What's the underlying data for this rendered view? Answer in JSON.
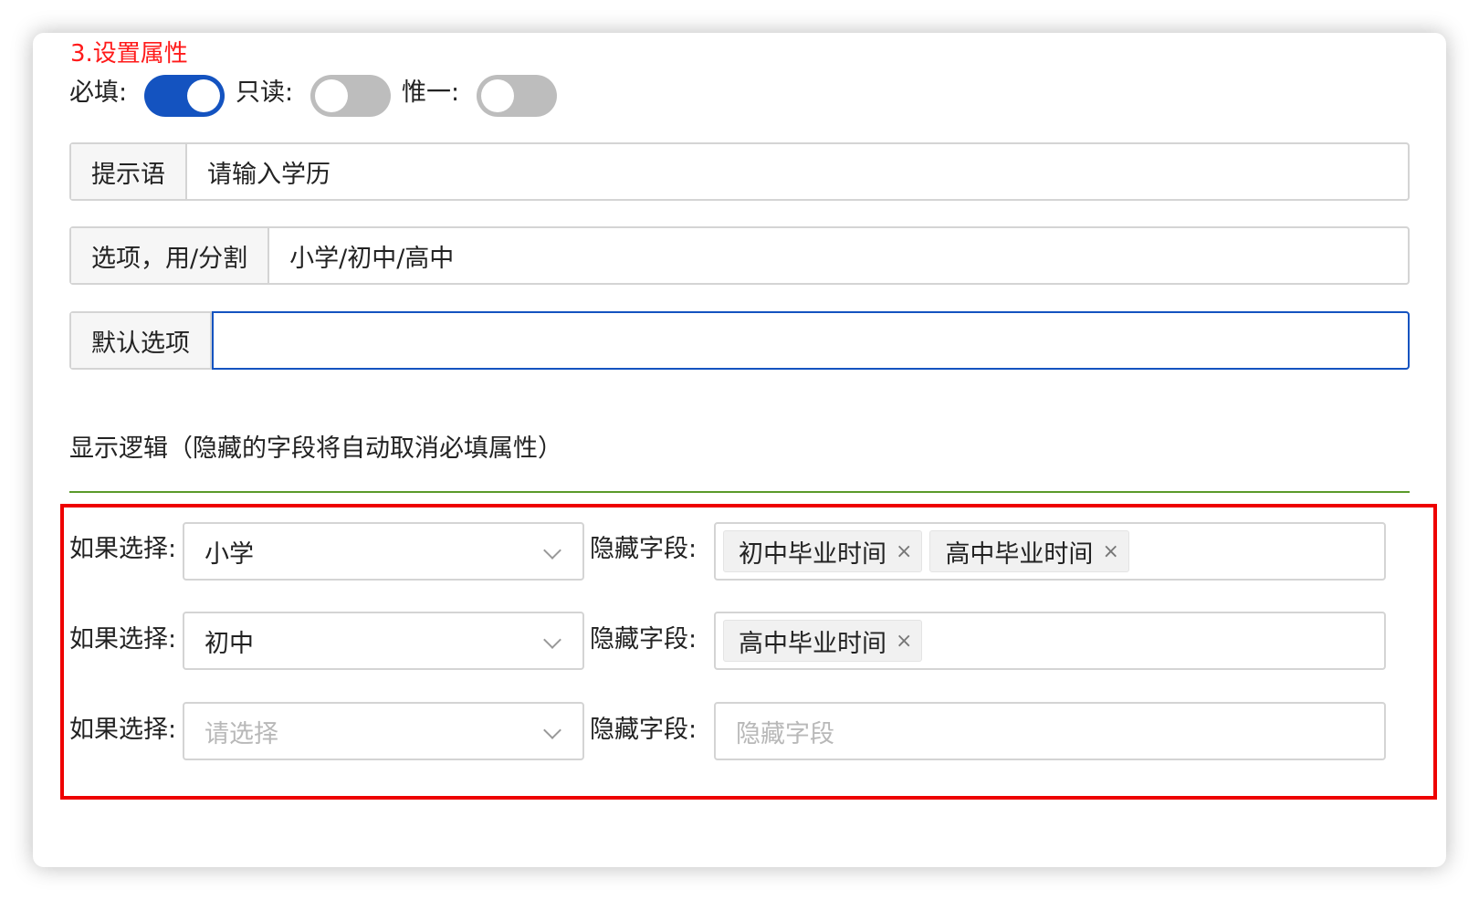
{
  "section_title": "3.设置属性",
  "toggles": [
    {
      "label": "必填:",
      "on": true
    },
    {
      "label": "只读:",
      "on": false
    },
    {
      "label": "惟一:",
      "on": false
    }
  ],
  "fields": {
    "prompt": {
      "label": "提示语",
      "value": "请输入学历"
    },
    "options": {
      "label": "选项，用/分割",
      "value": "小学/初中/高中"
    },
    "default": {
      "label": "默认选项",
      "value": ""
    }
  },
  "logic_heading": "显示逻辑（隐藏的字段将自动取消必填属性）",
  "rules": [
    {
      "if_label": "如果选择:",
      "selected": "小学",
      "hide_label": "隐藏字段:",
      "tags": [
        "初中毕业时间",
        "高中毕业时间"
      ]
    },
    {
      "if_label": "如果选择:",
      "selected": "初中",
      "hide_label": "隐藏字段:",
      "tags": [
        "高中毕业时间"
      ]
    },
    {
      "if_label": "如果选择:",
      "selected": "",
      "select_placeholder": "请选择",
      "hide_label": "隐藏字段:",
      "tags": [],
      "tags_placeholder": "隐藏字段"
    }
  ],
  "tag_remove_glyph": "×",
  "colors": {
    "accent": "#1453c0",
    "title_red": "#ff1a1a",
    "highlight_border": "#ee0000",
    "divider_green": "#5a9a2a"
  }
}
